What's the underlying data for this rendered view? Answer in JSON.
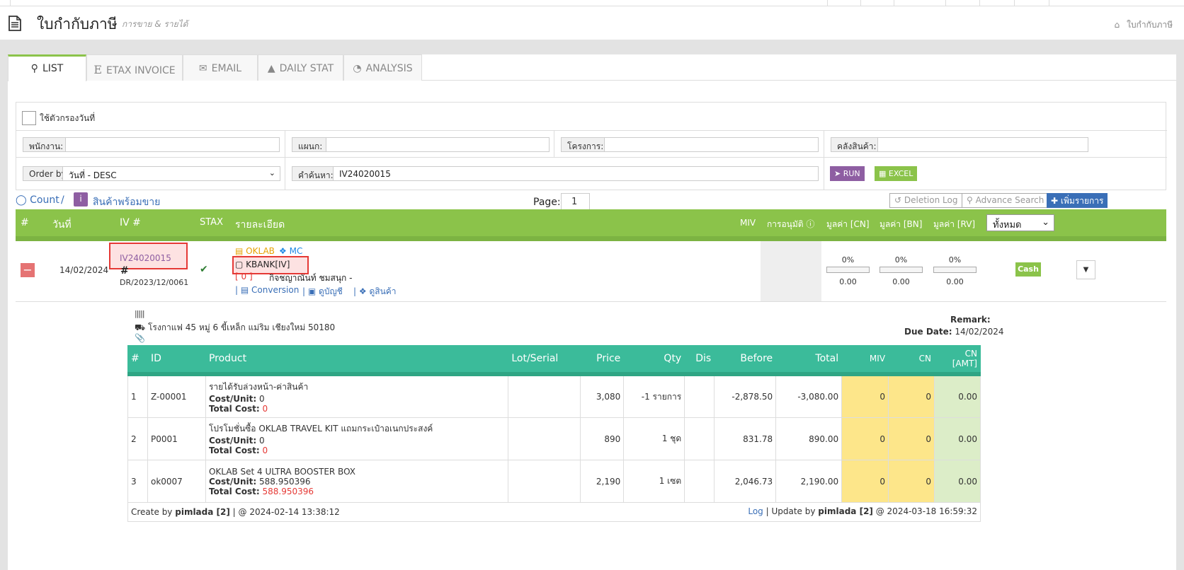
{
  "header": {
    "title": "ใบกำกับภาษี",
    "subtitle": "การขาย & รายได้",
    "breadcrumb": "ใบกำกับภาษี"
  },
  "tabs": [
    {
      "label": "LIST",
      "icon": "search-icon"
    },
    {
      "label": "ETAX INVOICE",
      "icon": "etax-icon"
    },
    {
      "label": "EMAIL",
      "icon": "envelope-icon"
    },
    {
      "label": "DAILY STAT",
      "icon": "area-chart-icon"
    },
    {
      "label": "ANALYSIS",
      "icon": "pie-chart-icon"
    }
  ],
  "filters": {
    "date_filter_label": "ใช้ตัวกรองวันที่",
    "employee_label": "พนักงาน:",
    "department_label": "แผนก:",
    "project_label": "โครงการ:",
    "warehouse_label": "คลังสินค้า:",
    "order_by_label": "Order by",
    "order_by_value": "วันที่ - DESC",
    "search_label": "คำค้นหา:",
    "search_value": "IV24020015",
    "run_label": "RUN",
    "excel_label": "EXCEL"
  },
  "toolbar": {
    "count_label": "Count",
    "ready_label": "สินค้าพร้อมขาย",
    "page_label": "Page:",
    "page_value": "1",
    "deletion_log_label": "Deletion Log",
    "advance_search_label": "Advance Search",
    "add_label": "เพิ่มรายการ"
  },
  "grid_headers": {
    "num": "#",
    "date": "วันที่",
    "iv": "IV #",
    "stax": "STAX",
    "detail": "รายละเอียด",
    "miv": "MIV",
    "approve": "การอนุมัติ",
    "cn": "มูลค่า [CN]",
    "bn": "มูลค่า [BN]",
    "rv": "มูลค่า [RV]",
    "filter_select": "ทั้งหมด"
  },
  "row": {
    "date": "14/02/2024",
    "iv_number": "IV24020015",
    "ref_hash": "#",
    "ref_number": "DR/2023/12/0061",
    "oklab": "OKLAB",
    "mc": "MC",
    "bank": "KBANK[IV]",
    "customer_code": "[ 0 ]",
    "customer_name": "กิจชญาณันท์ ชมสนุก -",
    "link_conversion": "Conversion",
    "link_account": "ดูบัญชี",
    "link_product": "ดูสินค้า",
    "cn_pct": "0%",
    "bn_pct": "0%",
    "rv_pct": "0%",
    "cn_progress": 0,
    "bn_progress": 0,
    "rv_progress": 0,
    "cn_val": "0.00",
    "bn_val": "0.00",
    "rv_val": "0.00",
    "payment": "Cash"
  },
  "detail": {
    "address": "โรงกาแฟ 45 หมู่ 6 ขี้เหล็ก แม่ริม เชียงใหม่ 50180",
    "remark_label": "Remark:",
    "due_label": "Due Date:",
    "due_value": "14/02/2024",
    "columns": [
      "#",
      "ID",
      "Product",
      "Lot/Serial",
      "Price",
      "Qty",
      "Dis",
      "Before",
      "Total",
      "MIV",
      "CN",
      "CN [AMT]"
    ],
    "items": [
      {
        "num": "1",
        "id": "Z-00001",
        "product": "รายได้รับล่วงหน้า-ค่าสินค้า",
        "cost_unit": "0",
        "total_cost": "0",
        "lot": "",
        "price": "3,080",
        "qty": "-1 รายการ",
        "dis": "",
        "before": "-2,878.50",
        "total": "-3,080.00",
        "miv": "0",
        "cn": "0",
        "cn_amt": "0.00"
      },
      {
        "num": "2",
        "id": "P0001",
        "product": "โปรโมชั่นซื้อ OKLAB TRAVEL KIT แถมกระเป๋าอเนกประสงค์",
        "cost_unit": "0",
        "total_cost": "0",
        "lot": "",
        "price": "890",
        "qty": "1 ชุด",
        "dis": "",
        "before": "831.78",
        "total": "890.00",
        "miv": "0",
        "cn": "0",
        "cn_amt": "0.00"
      },
      {
        "num": "3",
        "id": "ok0007",
        "product": "OKLAB Set 4 ULTRA BOOSTER BOX",
        "cost_unit": "588.950396",
        "total_cost": "588.950396",
        "lot": "",
        "price": "2,190",
        "qty": "1 เซต",
        "dis": "",
        "before": "2,046.73",
        "total": "2,190.00",
        "miv": "0",
        "cn": "0",
        "cn_amt": "0.00"
      }
    ],
    "cost_unit_label": "Cost/Unit:",
    "total_cost_label": "Total Cost:",
    "create_by_label": "Create by",
    "create_user": "pimlada [2]",
    "create_time": "| @ 2024-02-14 13:38:12",
    "log_label": "Log",
    "update_by_label": "| Update by",
    "update_user": "pimlada [2]",
    "update_time": "@ 2024-03-18 16:59:32"
  },
  "colors": {
    "green": "#8bc34a",
    "teal": "#3bbb9a",
    "purple": "#8e5ea2",
    "red": "#e53935",
    "link": "#3a6fb7"
  }
}
